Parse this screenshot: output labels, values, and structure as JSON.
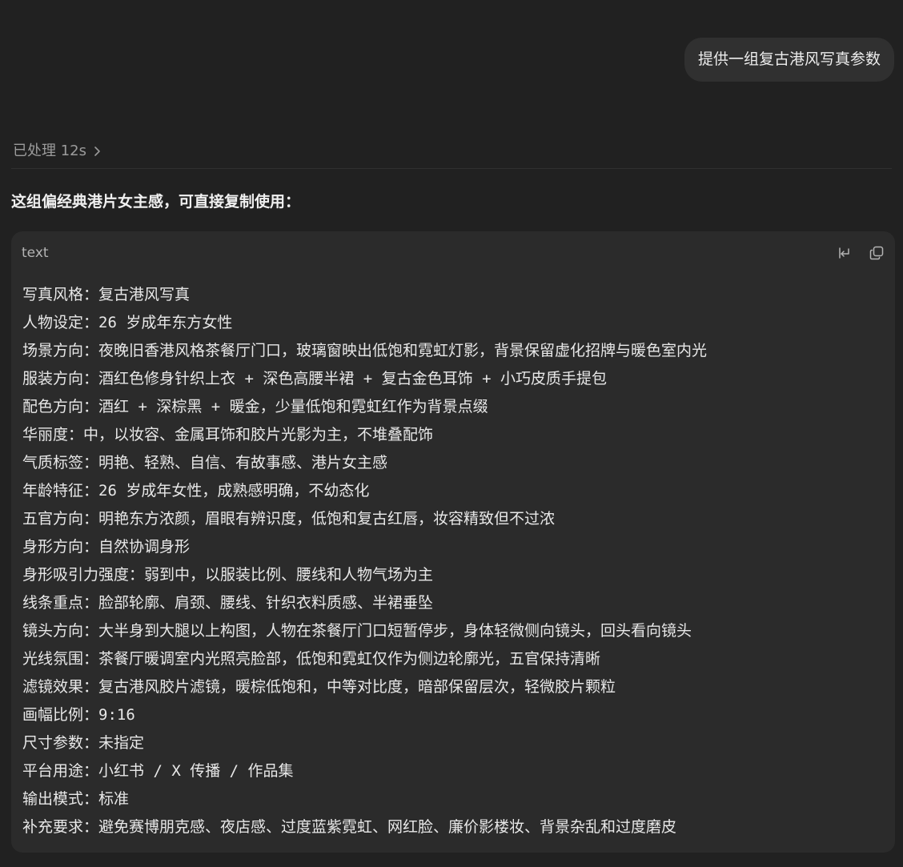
{
  "user_message": "提供一组复古港风写真参数",
  "thinking": {
    "label": "已处理 12s"
  },
  "assistant": {
    "intro": "这组偏经典港片女主感，可直接复制使用：",
    "code_block": {
      "language": "text",
      "lines": [
        "写真风格：复古港风写真",
        "人物设定：26 岁成年东方女性",
        "场景方向：夜晚旧香港风格茶餐厅门口，玻璃窗映出低饱和霓虹灯影，背景保留虚化招牌与暖色室内光",
        "服装方向：酒红色修身针织上衣 + 深色高腰半裙 + 复古金色耳饰 + 小巧皮质手提包",
        "配色方向：酒红 + 深棕黑 + 暖金，少量低饱和霓虹红作为背景点缀",
        "华丽度：中，以妆容、金属耳饰和胶片光影为主，不堆叠配饰",
        "气质标签：明艳、轻熟、自信、有故事感、港片女主感",
        "年龄特征：26 岁成年女性，成熟感明确，不幼态化",
        "五官方向：明艳东方浓颜，眉眼有辨识度，低饱和复古红唇，妆容精致但不过浓",
        "身形方向：自然协调身形",
        "身形吸引力强度：弱到中，以服装比例、腰线和人物气场为主",
        "线条重点：脸部轮廓、肩颈、腰线、针织衣料质感、半裙垂坠",
        "镜头方向：大半身到大腿以上构图，人物在茶餐厅门口短暂停步，身体轻微侧向镜头，回头看向镜头",
        "光线氛围：茶餐厅暖调室内光照亮脸部，低饱和霓虹仅作为侧边轮廓光，五官保持清晰",
        "滤镜效果：复古港风胶片滤镜，暖棕低饱和，中等对比度，暗部保留层次，轻微胶片颗粒",
        "画幅比例：9:16",
        "尺寸参数：未指定",
        "平台用途：小红书 / X 传播 / 作品集",
        "输出模式：标准",
        "补充要求：避免赛博朋克感、夜店感、过度蓝紫霓虹、网红脸、廉价影楼妆、背景杂乱和过度磨皮"
      ]
    }
  },
  "icons": {
    "thinking_chevron": "chevron-right-icon",
    "wrap": "wrap-lines-icon",
    "copy": "copy-icon"
  },
  "colors": {
    "background": "#212121",
    "user_bubble": "#303030",
    "code_block": "#2b2b2b",
    "text": "#ececec",
    "muted": "#9b9b9b"
  }
}
